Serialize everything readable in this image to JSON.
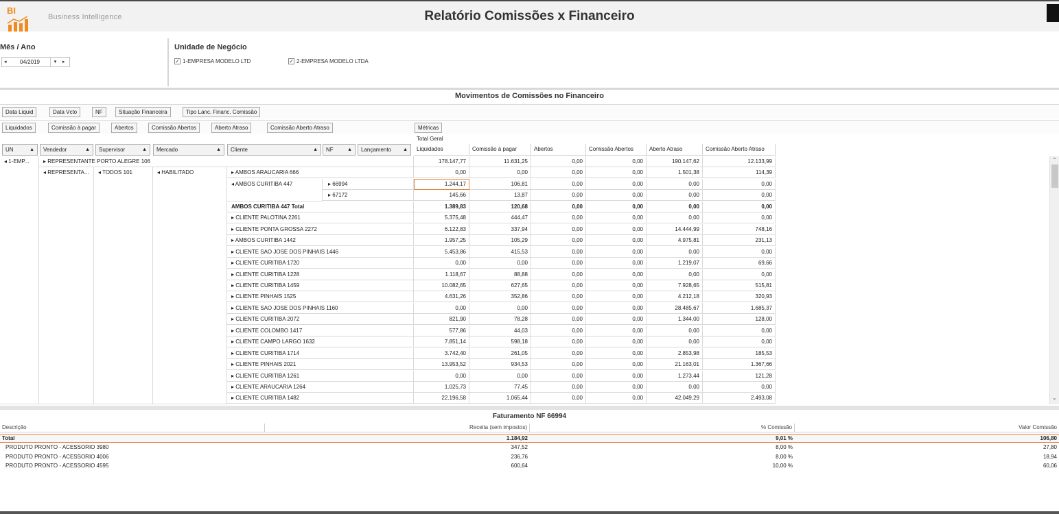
{
  "header": {
    "logo_text": "BI",
    "app_name": "Business Intelligence",
    "title": "Relatório Comissões x Financeiro"
  },
  "filters": {
    "month_title": "Mês / Ano",
    "month_value": "04/2019",
    "un_title": "Unidade de Negócio",
    "units": [
      {
        "label": "1-EMPRESA MODELO LTD",
        "checked": true
      },
      {
        "label": "2-EMPRESA MODELO LTDA",
        "checked": true
      }
    ]
  },
  "pivot": {
    "title": "Movimentos de Comissões no Financeiro",
    "filter_fields": [
      "Data Liquid",
      "Data Vcto",
      "NF",
      "Situação Financeira",
      "Tipo Lanc. Financ. Comissão"
    ],
    "data_fields": [
      "Liquidados",
      "Comissão à pagar",
      "Abertos",
      "Comissão Abertos",
      "Aberto Atraso",
      "Comissão Aberto Atraso"
    ],
    "column_area_label": "Métricas",
    "grand_total_label": "Total Geral",
    "row_fields": [
      "UN",
      "Vendedor",
      "Supervisor",
      "Mercado",
      "Cliente",
      "NF",
      "Lançamento"
    ],
    "value_columns": [
      "Liquidados",
      "Comissão à pagar",
      "Abertos",
      "Comissão Abertos",
      "Aberto Atraso",
      "Comissão Aberto Atraso"
    ],
    "un_value": "1-EMP...",
    "vendor_top": "REPRESENTANTE PORTO ALEGRE 106",
    "vendor_value": "REPRESENTA...",
    "supervisor_value": "TODOS   101",
    "market_value": "HABILITADO",
    "rows": [
      {
        "client": "",
        "nf": "",
        "values": [
          "178.147,77",
          "11.631,25",
          "0,00",
          "0,00",
          "190.147,62",
          "12.133,99"
        ],
        "kind": "top"
      },
      {
        "client": "AMBOS ARAUCARIA 666",
        "nf": "",
        "values": [
          "0,00",
          "0,00",
          "0,00",
          "0,00",
          "1.501,38",
          "114,39"
        ],
        "kind": "client"
      },
      {
        "client": "AMBOS CURITIBA 447",
        "nf": "66994",
        "values": [
          "1.244,17",
          "106,81",
          "0,00",
          "0,00",
          "0,00",
          "0,00"
        ],
        "kind": "expanded"
      },
      {
        "client": "",
        "nf": "67172",
        "values": [
          "145,66",
          "13,87",
          "0,00",
          "0,00",
          "0,00",
          "0,00"
        ],
        "kind": "nf"
      },
      {
        "client": "AMBOS CURITIBA 447 Total",
        "nf": "",
        "values": [
          "1.389,83",
          "120,68",
          "0,00",
          "0,00",
          "0,00",
          "0,00"
        ],
        "kind": "total"
      },
      {
        "client": "CLIENTE PALOTINA 2261",
        "nf": "",
        "values": [
          "5.375,48",
          "444,47",
          "0,00",
          "0,00",
          "0,00",
          "0,00"
        ],
        "kind": "client"
      },
      {
        "client": "CLIENTE PONTA GROSSA 2272",
        "nf": "",
        "values": [
          "6.122,83",
          "337,94",
          "0,00",
          "0,00",
          "14.444,99",
          "748,16"
        ],
        "kind": "client"
      },
      {
        "client": "AMBOS CURITIBA 1442",
        "nf": "",
        "values": [
          "1.957,25",
          "105,29",
          "0,00",
          "0,00",
          "4.975,81",
          "231,13"
        ],
        "kind": "client"
      },
      {
        "client": "CLIENTE SAO JOSE DOS PINHAIS 1446",
        "nf": "",
        "values": [
          "5.453,86",
          "415,53",
          "0,00",
          "0,00",
          "0,00",
          "0,00"
        ],
        "kind": "client"
      },
      {
        "client": "CLIENTE CURITIBA 1720",
        "nf": "",
        "values": [
          "0,00",
          "0,00",
          "0,00",
          "0,00",
          "1.219,07",
          "69,66"
        ],
        "kind": "client"
      },
      {
        "client": "CLIENTE CURITIBA 1228",
        "nf": "",
        "values": [
          "1.118,67",
          "88,88",
          "0,00",
          "0,00",
          "0,00",
          "0,00"
        ],
        "kind": "client"
      },
      {
        "client": "CLIENTE CURITIBA 1459",
        "nf": "",
        "values": [
          "10.082,65",
          "627,65",
          "0,00",
          "0,00",
          "7.928,65",
          "515,81"
        ],
        "kind": "client"
      },
      {
        "client": "CLIENTE PINHAIS 1525",
        "nf": "",
        "values": [
          "4.631,26",
          "352,86",
          "0,00",
          "0,00",
          "4.212,18",
          "320,93"
        ],
        "kind": "client"
      },
      {
        "client": "CLIENTE SAO JOSE DOS PINHAIS 1160",
        "nf": "",
        "values": [
          "0,00",
          "0,00",
          "0,00",
          "0,00",
          "28.485,67",
          "1.685,37"
        ],
        "kind": "client"
      },
      {
        "client": "CLIENTE CURITIBA 2072",
        "nf": "",
        "values": [
          "821,90",
          "78,28",
          "0,00",
          "0,00",
          "1.344,00",
          "128,00"
        ],
        "kind": "client"
      },
      {
        "client": "CLIENTE COLOMBO 1417",
        "nf": "",
        "values": [
          "577,86",
          "44,03",
          "0,00",
          "0,00",
          "0,00",
          "0,00"
        ],
        "kind": "client"
      },
      {
        "client": "CLIENTE CAMPO LARGO 1632",
        "nf": "",
        "values": [
          "7.851,14",
          "598,18",
          "0,00",
          "0,00",
          "0,00",
          "0,00"
        ],
        "kind": "client"
      },
      {
        "client": "CLIENTE CURITIBA 1714",
        "nf": "",
        "values": [
          "3.742,40",
          "261,05",
          "0,00",
          "0,00",
          "2.853,98",
          "185,53"
        ],
        "kind": "client"
      },
      {
        "client": "CLIENTE PINHAIS 2021",
        "nf": "",
        "values": [
          "13.953,52",
          "934,53",
          "0,00",
          "0,00",
          "21.163,01",
          "1.367,66"
        ],
        "kind": "client"
      },
      {
        "client": "CLIENTE CURITIBA 1261",
        "nf": "",
        "values": [
          "0,00",
          "0,00",
          "0,00",
          "0,00",
          "1.273,44",
          "121,28"
        ],
        "kind": "client"
      },
      {
        "client": "CLIENTE ARAUCARIA 1264",
        "nf": "",
        "values": [
          "1.025,73",
          "77,45",
          "0,00",
          "0,00",
          "0,00",
          "0,00"
        ],
        "kind": "client"
      },
      {
        "client": "CLIENTE CURITIBA 1482",
        "nf": "",
        "values": [
          "22.196,58",
          "1.065,44",
          "0,00",
          "0,00",
          "42.049,29",
          "2.493,08"
        ],
        "kind": "client"
      }
    ]
  },
  "invoice": {
    "title": "Faturamento  NF 66994",
    "columns": [
      "Descrição",
      "Receita (sem impostos)",
      "% Comissão",
      "Valor Comissão"
    ],
    "total": {
      "desc": "Total",
      "receita": "1.184,92",
      "pct": "9,01 %",
      "valor": "106,80"
    },
    "items": [
      {
        "desc": "PRODUTO PRONTO - ACESSORIO 3980",
        "receita": "347,52",
        "pct": "8,00 %",
        "valor": "27,80"
      },
      {
        "desc": "PRODUTO PRONTO - ACESSORIO 4006",
        "receita": "236,76",
        "pct": "8,00 %",
        "valor": "18,94"
      },
      {
        "desc": "PRODUTO PRONTO - ACESSORIO 4595",
        "receita": "600,64",
        "pct": "10,00 %",
        "valor": "60,06"
      }
    ]
  },
  "colors": {
    "accent": "#f28a1e",
    "selection": "#e5863b"
  }
}
